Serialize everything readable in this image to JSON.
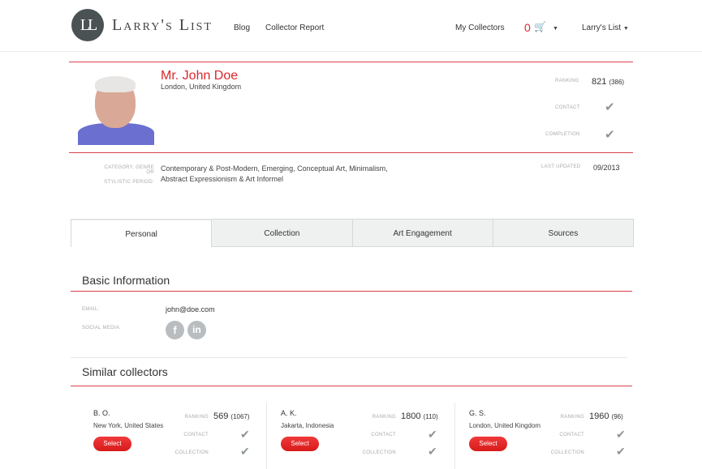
{
  "header": {
    "logo_mark": "LL",
    "logo_text": "Larry's List",
    "nav": [
      "Blog",
      "Collector Report"
    ],
    "my_collectors": "My Collectors",
    "cart_count": "0",
    "account_menu": "Larry's List"
  },
  "profile": {
    "name": "Mr. John Doe",
    "location": "London, United Kingdom",
    "ranking_label": "RANKING",
    "ranking_value": "821",
    "ranking_total": "(386)",
    "contact_label": "CONTACT",
    "completion_label": "COMPLETION",
    "category_label_line1": "CATEGORY, GENRE OR",
    "category_label_line2": "STYLISTIC PERIOD:",
    "categories": "Contemporary & Post-Modern, Emerging, Conceptual Art, Minimalism, Abstract Expressionism & Art Informel",
    "last_updated_label": "LAST UPDATED",
    "last_updated_value": "09/2013"
  },
  "tabs": [
    {
      "label": "Personal",
      "active": true
    },
    {
      "label": "Collection",
      "active": false
    },
    {
      "label": "Art Engagement",
      "active": false
    },
    {
      "label": "Sources",
      "active": false
    }
  ],
  "basic_info": {
    "title": "Basic Information",
    "email_label": "EMAIL:",
    "email_value": "john@doe.com",
    "social_label": "SOCIAL MEDIA:",
    "social": [
      "f",
      "in"
    ]
  },
  "similar": {
    "title": "Similar collectors",
    "ranking_label": "RANKING",
    "contact_label": "CONTACT",
    "collection_label": "COLLECTION",
    "select_label": "Select",
    "collectors": [
      {
        "initials": "B. O.",
        "location": "New York, United States",
        "ranking": "569",
        "total": "(1067)"
      },
      {
        "initials": "A. K.",
        "location": "Jakarta, Indonesia",
        "ranking": "1800",
        "total": "(110)"
      },
      {
        "initials": "G. S.",
        "location": "London, United Kingdom",
        "ranking": "1960",
        "total": "(96)"
      }
    ]
  },
  "colors": {
    "accent": "#d9282d",
    "rule": "#d9414a",
    "check": "#8e9497",
    "logo": "#4b5254"
  }
}
